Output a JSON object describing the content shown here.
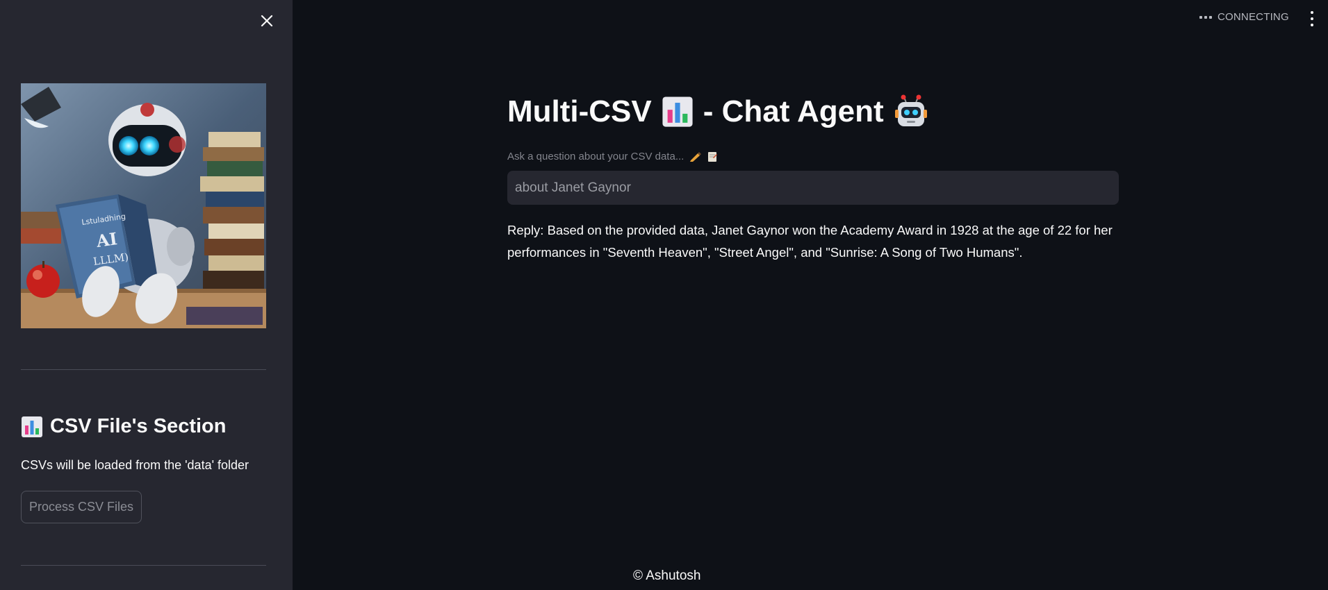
{
  "sidebar": {
    "section_title": "CSV File's Section",
    "section_icon": "bar-chart-emoji",
    "description": "CSVs will be loaded from the 'data' folder",
    "process_button_label": "Process CSV Files",
    "hero_image_text_1": "Lstuladhing",
    "hero_image_text_2": "AI",
    "hero_image_text_3": "LLLM)"
  },
  "topbar": {
    "status": "CONNECTING"
  },
  "main": {
    "title": "Multi-CSV",
    "title_suffix": "- Chat Agent",
    "input_label": "Ask a question about your CSV data...",
    "input_value": "about Janet Gaynor",
    "reply": "Reply: Based on the provided data, Janet Gaynor won the Academy Award in 1928 at the age of 22 for her performances in \"Seventh Heaven\", \"Street Angel\", and \"Sunrise: A Song of Two Humans\"."
  },
  "footer": {
    "text": "© Ashutosh"
  },
  "colors": {
    "background": "#0e1117",
    "sidebar": "#262730",
    "input_bg": "#262730",
    "text": "#fafafa",
    "muted": "#83858d"
  }
}
